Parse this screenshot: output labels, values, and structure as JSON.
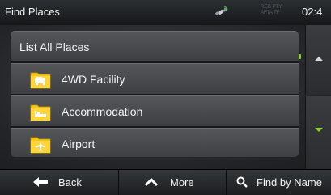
{
  "titlebar": {
    "title": "Find Places",
    "gps_status": [
      "REG PTY",
      "AFTA TF"
    ],
    "clock": "02:4"
  },
  "list": {
    "items": [
      {
        "label": "List All Places",
        "icon": null
      },
      {
        "label": "4WD Facility",
        "icon": "jeep-folder-icon"
      },
      {
        "label": "Accommodation",
        "icon": "bed-folder-icon"
      },
      {
        "label": "Airport",
        "icon": "airplane-folder-icon"
      }
    ]
  },
  "bottombar": {
    "back_label": "Back",
    "more_label": "More",
    "find_label": "Find by Name"
  },
  "colors": {
    "accent_green": "#8bd12a",
    "folder_yellow": "#f5c518"
  }
}
